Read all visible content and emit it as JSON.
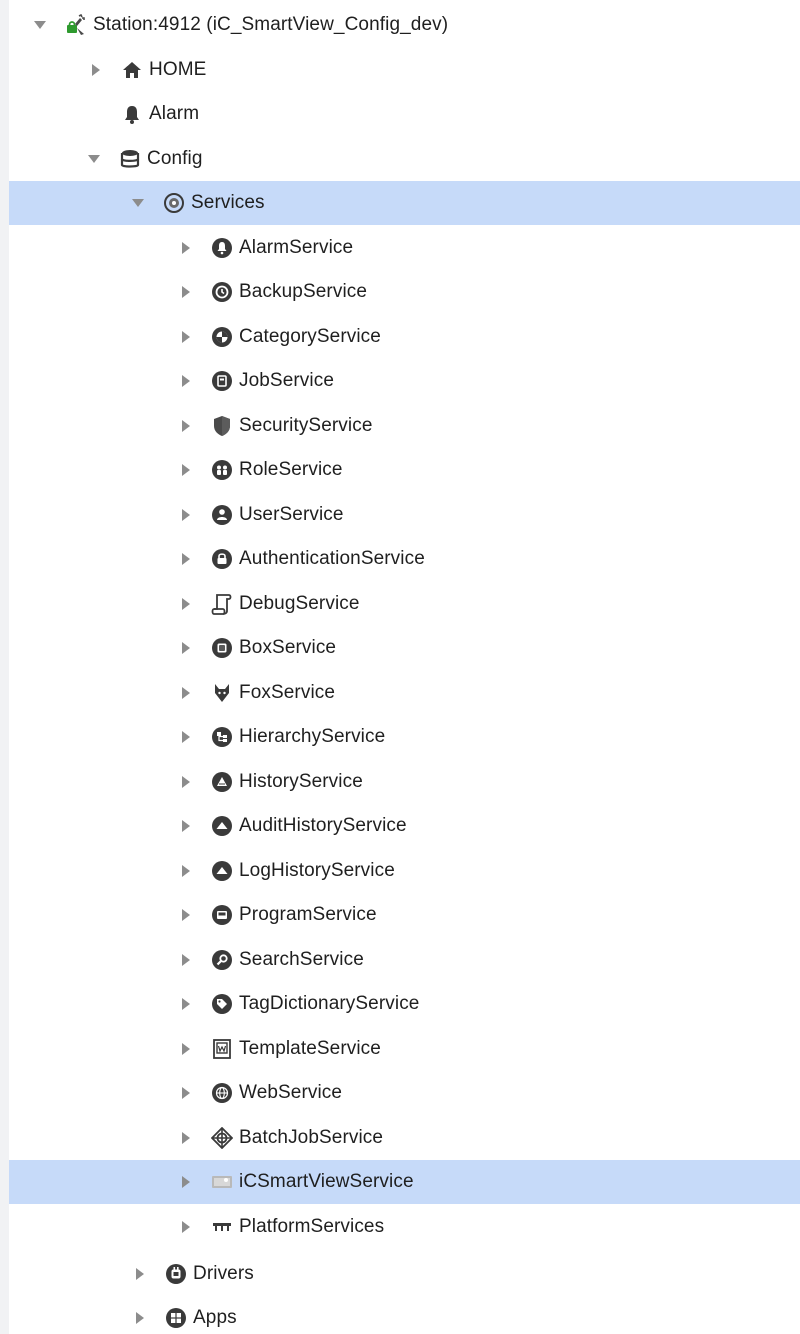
{
  "tree": {
    "station": {
      "label": "Station:4912 (iC_SmartView_Config_dev)",
      "icon": "station-plug-icon",
      "expanded": true
    },
    "home": {
      "label": "HOME",
      "icon": "home-icon",
      "expanded": false
    },
    "alarm": {
      "label": "Alarm",
      "icon": "bell-icon"
    },
    "config": {
      "label": "Config",
      "icon": "database-icon",
      "expanded": true
    },
    "services": {
      "label": "Services",
      "icon": "globe-gear-icon",
      "expanded": true,
      "selected": true
    },
    "service_items": [
      {
        "label": "AlarmService",
        "icon": "alarm-service-icon"
      },
      {
        "label": "BackupService",
        "icon": "backup-service-icon"
      },
      {
        "label": "CategoryService",
        "icon": "category-service-icon"
      },
      {
        "label": "JobService",
        "icon": "job-service-icon"
      },
      {
        "label": "SecurityService",
        "icon": "shield-icon"
      },
      {
        "label": "RoleService",
        "icon": "role-service-icon"
      },
      {
        "label": "UserService",
        "icon": "user-service-icon"
      },
      {
        "label": "AuthenticationService",
        "icon": "lock-icon"
      },
      {
        "label": "DebugService",
        "icon": "scroll-icon"
      },
      {
        "label": "BoxService",
        "icon": "box-service-icon"
      },
      {
        "label": "FoxService",
        "icon": "fox-icon"
      },
      {
        "label": "HierarchyService",
        "icon": "hierarchy-icon"
      },
      {
        "label": "HistoryService",
        "icon": "history-icon"
      },
      {
        "label": "AuditHistoryService",
        "icon": "audit-history-icon"
      },
      {
        "label": "LogHistoryService",
        "icon": "log-history-icon"
      },
      {
        "label": "ProgramService",
        "icon": "program-icon"
      },
      {
        "label": "SearchService",
        "icon": "search-icon"
      },
      {
        "label": "TagDictionaryService",
        "icon": "tag-icon"
      },
      {
        "label": "TemplateService",
        "icon": "template-icon"
      },
      {
        "label": "WebService",
        "icon": "web-globe-icon"
      },
      {
        "label": "BatchJobService",
        "icon": "crosshair-icon"
      },
      {
        "label": "iCSmartViewService",
        "icon": "smartview-icon",
        "selected": true
      },
      {
        "label": "PlatformServices",
        "icon": "platform-icon"
      }
    ],
    "drivers": {
      "label": "Drivers",
      "icon": "drivers-icon",
      "expanded": false
    },
    "apps": {
      "label": "Apps",
      "icon": "apps-icon",
      "expanded": false
    }
  },
  "colors": {
    "selection": "#c6daf9",
    "icon": "#4a4a4a",
    "toggle": "#8c8c8c",
    "station_green": "#2f9a2f"
  }
}
